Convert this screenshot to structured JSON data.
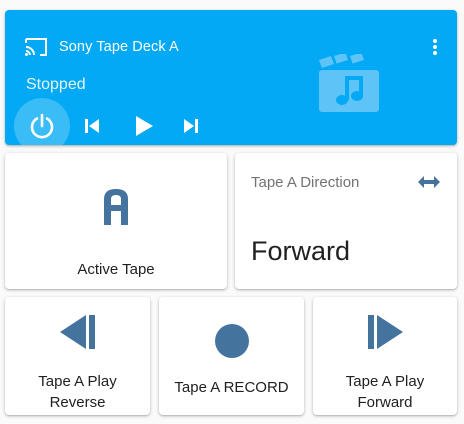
{
  "media_player": {
    "title": "Sony Tape Deck A",
    "state": "Stopped",
    "icons": {
      "source": "cast-icon",
      "menu": "dots-vertical-icon",
      "art": "movie-music-icon",
      "power": "power-icon",
      "previous": "skip-previous-icon",
      "play": "play-icon",
      "next": "skip-next-icon"
    },
    "colors": {
      "background": "#03a9f4",
      "foreground": "#ffffff"
    }
  },
  "active_tape": {
    "label": "Active Tape",
    "value_glyph": "A",
    "icon_color": "#44739e"
  },
  "direction": {
    "title": "Tape A Direction",
    "value": "Forward",
    "icon": "swap-horizontal-icon"
  },
  "buttons": [
    {
      "label_line1": "Tape A Play",
      "label_line2": "Reverse",
      "icon": "play-reverse-icon"
    },
    {
      "label": "Tape A RECORD",
      "icon": "record-icon"
    },
    {
      "label_line1": "Tape A Play",
      "label_line2": "Forward",
      "icon": "play-forward-icon"
    }
  ],
  "colors": {
    "icon": "#44739e",
    "text": "#212121",
    "secondary_text": "#727272"
  }
}
